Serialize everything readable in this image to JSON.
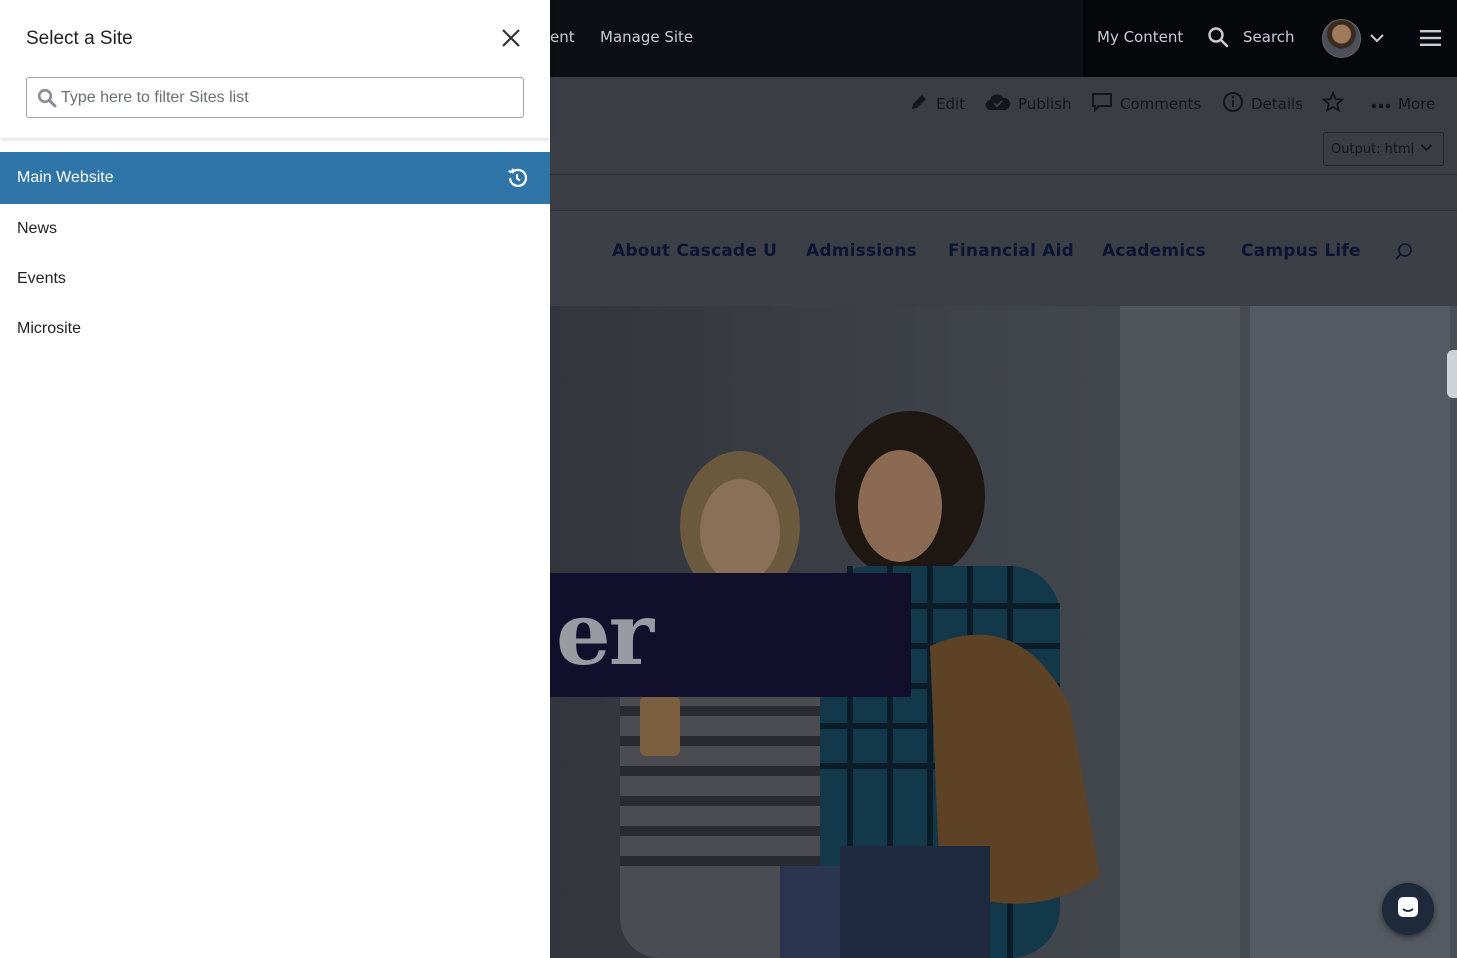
{
  "topbar": {
    "partial_nav_label": "ent",
    "manage_site_label": "Manage Site",
    "my_content_label": "My Content",
    "search_label": "Search"
  },
  "toolbar": {
    "edit_label": "Edit",
    "publish_label": "Publish",
    "comments_label": "Comments",
    "details_label": "Details",
    "more_label": "More",
    "output_label": "Output: html"
  },
  "site_nav": {
    "links": [
      "About Cascade U",
      "Admissions",
      "Financial Aid",
      "Academics",
      "Campus Life"
    ]
  },
  "hero": {
    "banner_text": "er"
  },
  "panel": {
    "title": "Select a Site",
    "filter_placeholder": "Type here to filter Sites list",
    "filter_value": "",
    "sites": [
      {
        "label": "Main Website",
        "active": true
      },
      {
        "label": "News",
        "active": false
      },
      {
        "label": "Events",
        "active": false
      },
      {
        "label": "Microsite",
        "active": false
      }
    ]
  },
  "colors": {
    "active_site": "#2f75a8",
    "topbar": "#0d0f14",
    "nav_link": "#0c1533"
  },
  "icons": {
    "close": "close-icon",
    "filter_search": "magnifier-icon",
    "history": "history-icon",
    "edit": "pencil-icon",
    "publish": "cloud-check-icon",
    "comments": "comment-icon",
    "details": "info-icon",
    "favorite": "star-icon",
    "more": "ellipsis-icon",
    "menu": "hamburger-icon",
    "chat": "chat-icon"
  }
}
